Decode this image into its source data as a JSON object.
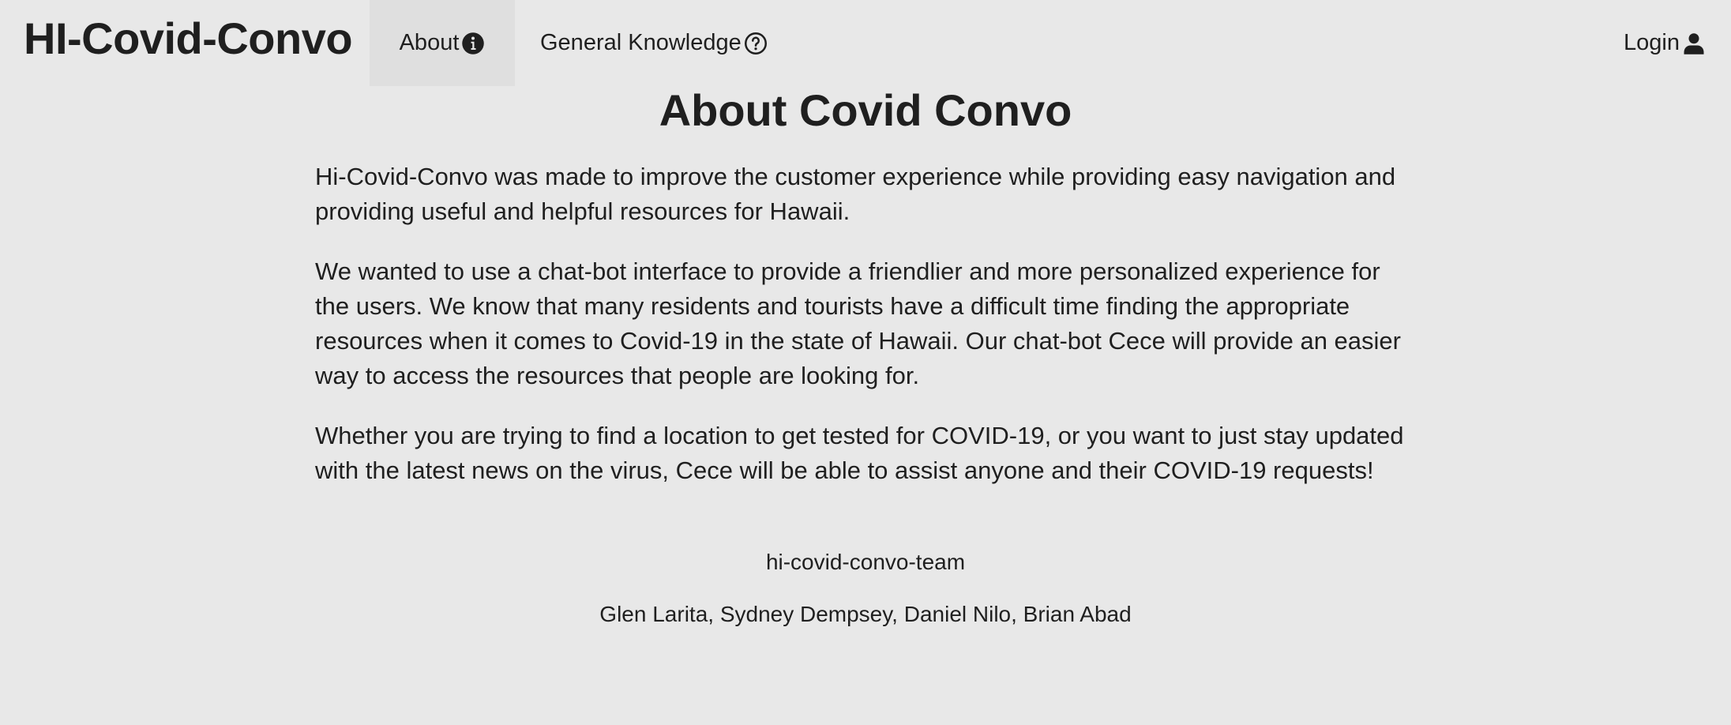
{
  "navbar": {
    "brand": "HI-Covid-Convo",
    "items": [
      {
        "label": "About",
        "icon": "info-circle-icon",
        "active": true
      },
      {
        "label": "General Knowledge",
        "icon": "question-circle-icon",
        "active": false
      }
    ],
    "login": {
      "label": "Login",
      "icon": "user-icon"
    }
  },
  "main": {
    "title": "About Covid Convo",
    "paragraphs": [
      "Hi-Covid-Convo was made to improve the customer experience while providing easy navigation and providing useful and helpful resources for Hawaii.",
      "We wanted to use a chat-bot interface to provide a friendlier and more personalized experience for the users. We know that many residents and tourists have a difficult time finding the appropriate resources when it comes to Covid-19 in the state of Hawaii. Our chat-bot Cece will provide an easier way to access the resources that people are looking for.",
      "Whether you are trying to find a location to get tested for COVID-19, or you want to just stay updated with the latest news on the virus, Cece will be able to assist anyone and their COVID-19 requests!"
    ],
    "team_label": "hi-covid-convo-team",
    "team_members": "Glen Larita, Sydney Dempsey, Daniel Nilo, Brian Abad"
  },
  "colors": {
    "background": "#e8e8e8",
    "active_nav": "#dfdfdf",
    "text": "#1f1f1f"
  }
}
